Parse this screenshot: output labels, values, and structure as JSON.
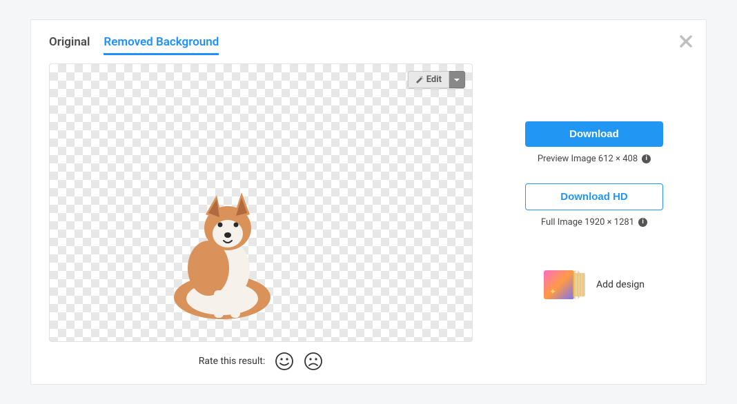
{
  "tabs": {
    "original": "Original",
    "removed": "Removed Background"
  },
  "edit": {
    "label": "Edit"
  },
  "rate": {
    "label": "Rate this result:"
  },
  "download": {
    "primary": "Download",
    "previewText": "Preview Image 612 × 408",
    "hd": "Download HD",
    "fullText": "Full Image 1920 × 1281"
  },
  "design": {
    "label": "Add design"
  }
}
